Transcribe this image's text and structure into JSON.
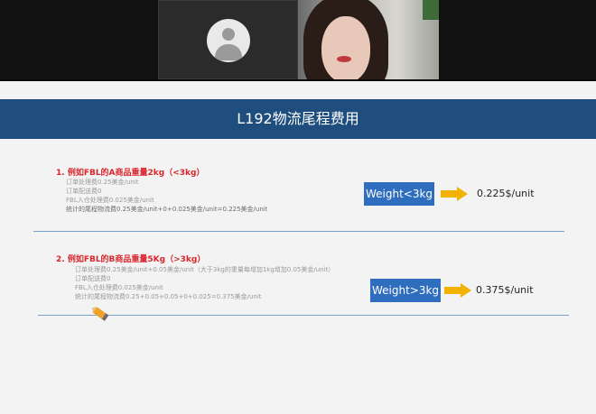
{
  "slide": {
    "title": "L192物流尾程费用",
    "example_a": {
      "heading": "1. 例如FBL的A商品重量2kg（<3kg）",
      "lines": [
        "订单处理费0.25美金/unit",
        "订单配送费0",
        "FBL入仓处理费0.025美金/unit",
        "统计的尾程物流费0.25美金/unit+0+0.025美金/unit=0.225美金/unit"
      ],
      "weight_label": "Weight<3kg",
      "price": "0.225$/unit"
    },
    "example_b": {
      "heading": "2. 例如FBL的B商品重量5Kg（>3kg）",
      "lines": [
        "订单处理费0.25美金/unit+0.05美金/unit（大于3kg的重量每增加1kg增加0.05美金/unit）",
        "订单配送费0",
        "FBL入仓处理费0.025美金/unit",
        "统计的尾程物流费0.25+0.05+0.05+0+0.025=0.375美金/unit"
      ],
      "weight_label": "Weight>3kg",
      "price": "0.375$/unit"
    }
  },
  "colors": {
    "title_bar": "#1f4e7e",
    "weight_box": "#2f6ebe",
    "arrow": "#f2b200",
    "heading": "#d9262c",
    "separator": "#7ba0c7"
  },
  "icons": [
    "avatar-icon",
    "pencil-icon",
    "arrow-right-icon"
  ]
}
